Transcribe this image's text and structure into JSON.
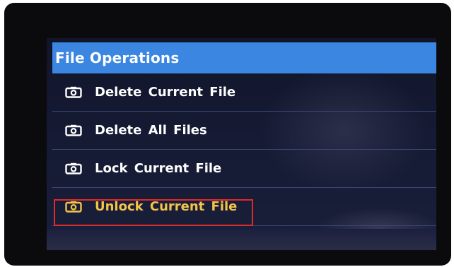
{
  "screen": {
    "title": "File Operations",
    "items": [
      {
        "label": "Delete Current File",
        "icon": "camera-icon",
        "selected": false
      },
      {
        "label": "Delete All Files",
        "icon": "camera-icon",
        "selected": false
      },
      {
        "label": "Lock Current File",
        "icon": "camera-icon",
        "selected": false
      },
      {
        "label": "Unlock Current File",
        "icon": "camera-icon",
        "selected": true
      }
    ]
  },
  "colors": {
    "header_bg": "#3b86e0",
    "text": "#ffffff",
    "selected_text": "#f4c34a",
    "highlight_border": "#e02a2a",
    "screen_bg": "#151a33"
  }
}
